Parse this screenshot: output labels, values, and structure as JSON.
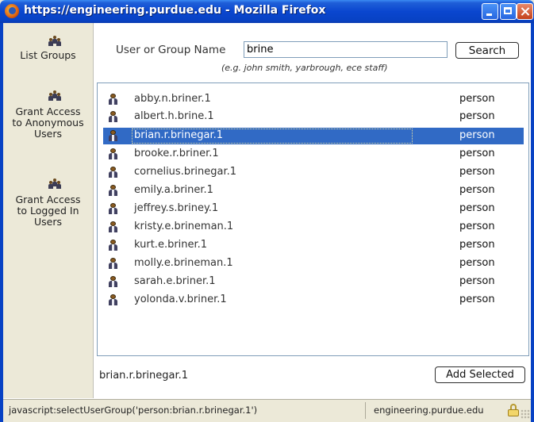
{
  "window": {
    "title": "https://engineering.purdue.edu - Mozilla Firefox"
  },
  "sidebar": {
    "items": [
      {
        "label": "List Groups",
        "icon": "people-group-icon"
      },
      {
        "label": "Grant Access to Anonymous Users",
        "icon": "people-group-icon"
      },
      {
        "label": "Grant Access to Logged In Users",
        "icon": "people-group-icon"
      }
    ]
  },
  "search": {
    "label": "User or Group Name",
    "value": "brine",
    "button_label": "Search",
    "hint": "(e.g. john smith, yarbrough, ece staff)"
  },
  "results": {
    "selected_index": 2,
    "rows": [
      {
        "name": "abby.n.briner.1",
        "type": "person"
      },
      {
        "name": "albert.h.brine.1",
        "type": "person"
      },
      {
        "name": "brian.r.brinegar.1",
        "type": "person"
      },
      {
        "name": "brooke.r.briner.1",
        "type": "person"
      },
      {
        "name": "cornelius.brinegar.1",
        "type": "person"
      },
      {
        "name": "emily.a.briner.1",
        "type": "person"
      },
      {
        "name": "jeffrey.s.briney.1",
        "type": "person"
      },
      {
        "name": "kristy.e.brineman.1",
        "type": "person"
      },
      {
        "name": "kurt.e.briner.1",
        "type": "person"
      },
      {
        "name": "molly.e.brineman.1",
        "type": "person"
      },
      {
        "name": "sarah.e.briner.1",
        "type": "person"
      },
      {
        "name": "yolonda.v.briner.1",
        "type": "person"
      }
    ]
  },
  "selection": {
    "value": "brian.r.brinegar.1",
    "add_button_label": "Add Selected"
  },
  "statusbar": {
    "text": "javascript:selectUserGroup('person:brian.r.brinegar.1')",
    "domain": "engineering.purdue.edu"
  },
  "colors": {
    "titlebar": "#0842c4",
    "selection": "#316ac5",
    "chrome": "#ece9d8"
  }
}
